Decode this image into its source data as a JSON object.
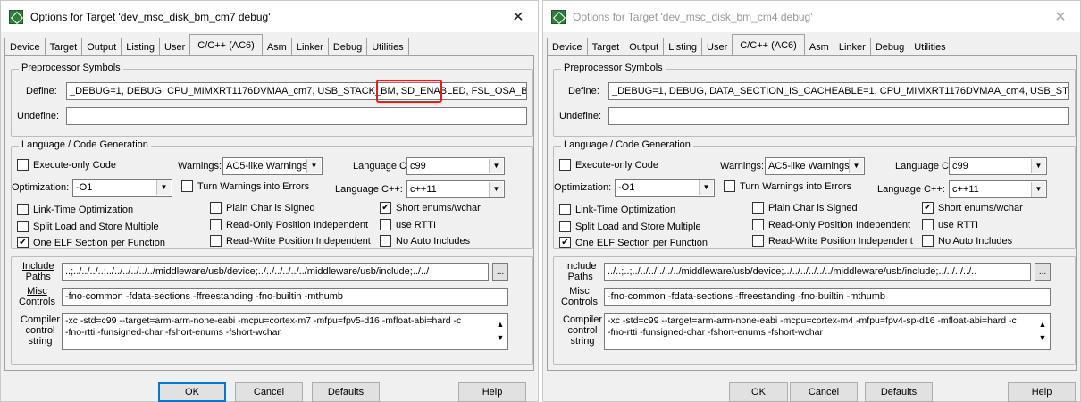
{
  "left": {
    "title": "Options for Target 'dev_msc_disk_bm_cm7 debug'",
    "close": "✕",
    "tabs": [
      "Device",
      "Target",
      "Output",
      "Listing",
      "User",
      "C/C++ (AC6)",
      "Asm",
      "Linker",
      "Debug",
      "Utilities"
    ],
    "active_tab": "C/C++ (AC6)",
    "preprocessor": {
      "label": "Preprocessor Symbols",
      "define_label": "Define:",
      "define_value": "_DEBUG=1, DEBUG, CPU_MIMXRT1176DVMAA_cm7, USB_STACK_BM, SD_ENABLED, FSL_OSA_B",
      "highlight_text": "SD_ENABLED,",
      "undefine_label": "Undefine:",
      "undefine_value": ""
    },
    "lang": {
      "label": "Language / Code Generation",
      "execute_only": "Execute-only Code",
      "warnings_label": "Warnings:",
      "warnings_value": "AC5-like Warnings",
      "language_c_label": "Language C:",
      "language_c_value": "c99",
      "optimization_label": "Optimization:",
      "optimization_value": "-O1",
      "turn_warnings": "Turn Warnings into Errors",
      "language_cpp_label": "Language C++:",
      "language_cpp_value": "c++11",
      "link_time": "Link-Time Optimization",
      "plain_char": "Plain Char is Signed",
      "short_enums": "Short enums/wchar",
      "split_load": "Split Load and Store Multiple",
      "read_only": "Read-Only Position Independent",
      "use_rtti": "use RTTI",
      "one_elf": "One ELF Section per Function",
      "read_write": "Read-Write Position Independent",
      "no_auto": "No Auto Includes"
    },
    "include_label_1": "Include",
    "include_label_2": "Paths",
    "include_value": "..;../../../..;../../../../../../middleware/usb/device;../../../../../../middleware/usb/include;../../",
    "browse": "...",
    "misc_label_1": "Misc",
    "misc_label_2": "Controls",
    "misc_value": "-fno-common  -fdata-sections  -ffreestanding  -fno-builtin  -mthumb",
    "compiler_label_1": "Compiler",
    "compiler_label_2": "control",
    "compiler_label_3": "string",
    "compiler_line1": "-xc -std=c99 --target=arm-arm-none-eabi -mcpu=cortex-m7 -mfpu=fpv5-d16 -mfloat-abi=hard -c",
    "compiler_line2": "-fno-rtti -funsigned-char -fshort-enums -fshort-wchar",
    "buttons": {
      "ok": "OK",
      "cancel": "Cancel",
      "defaults": "Defaults",
      "help": "Help"
    }
  },
  "right": {
    "title": "Options for Target 'dev_msc_disk_bm_cm4 debug'",
    "close": "✕",
    "tabs": [
      "Device",
      "Target",
      "Output",
      "Listing",
      "User",
      "C/C++ (AC6)",
      "Asm",
      "Linker",
      "Debug",
      "Utilities"
    ],
    "active_tab": "C/C++ (AC6)",
    "preprocessor": {
      "label": "Preprocessor Symbols",
      "define_label": "Define:",
      "define_value": "_DEBUG=1, DEBUG, DATA_SECTION_IS_CACHEABLE=1, CPU_MIMXRT1176DVMAA_cm4, USB_ST",
      "undefine_label": "Undefine:",
      "undefine_value": ""
    },
    "lang": {
      "label": "Language / Code Generation",
      "execute_only": "Execute-only Code",
      "warnings_label": "Warnings:",
      "warnings_value": "AC5-like Warnings",
      "language_c_label": "Language C:",
      "language_c_value": "c99",
      "optimization_label": "Optimization:",
      "optimization_value": "-O1",
      "turn_warnings": "Turn Warnings into Errors",
      "language_cpp_label": "Language C++:",
      "language_cpp_value": "c++11",
      "link_time": "Link-Time Optimization",
      "plain_char": "Plain Char is Signed",
      "short_enums": "Short enums/wchar",
      "split_load": "Split Load and Store Multiple",
      "read_only": "Read-Only Position Independent",
      "use_rtti": "use RTTI",
      "one_elf": "One ELF Section per Function",
      "read_write": "Read-Write Position Independent",
      "no_auto": "No Auto Includes"
    },
    "include_label_1": "Include",
    "include_label_2": "Paths",
    "include_value": "../..;..;../../../../../../middleware/usb/device;../../../../../../middleware/usb/include;../../../../..",
    "browse": "...",
    "misc_label_1": "Misc",
    "misc_label_2": "Controls",
    "misc_value": "-fno-common  -fdata-sections  -ffreestanding  -fno-builtin  -mthumb",
    "compiler_label_1": "Compiler",
    "compiler_label_2": "control",
    "compiler_label_3": "string",
    "compiler_line1": "-xc -std=c99 --target=arm-arm-none-eabi -mcpu=cortex-m4 -mfpu=fpv4-sp-d16 -mfloat-abi=hard -c",
    "compiler_line2": "-fno-rtti -funsigned-char -fshort-enums -fshort-wchar",
    "buttons": {
      "ok": "OK",
      "cancel": "Cancel",
      "defaults": "Defaults",
      "help": "Help"
    }
  },
  "checkbox_states": {
    "execute_only": false,
    "turn_warnings": false,
    "link_time": false,
    "plain_char": false,
    "short_enums": true,
    "split_load": false,
    "read_only": false,
    "use_rtti": false,
    "one_elf": true,
    "read_write": false,
    "no_auto": false
  },
  "icons": {
    "check": "✔",
    "dropdown": "▼",
    "scroll_up": "▲",
    "scroll_down": "▼"
  },
  "colors": {
    "highlight": "#e02020",
    "app_icon": "#2f7d3a",
    "dialog_bg": "#f0f0f0"
  }
}
